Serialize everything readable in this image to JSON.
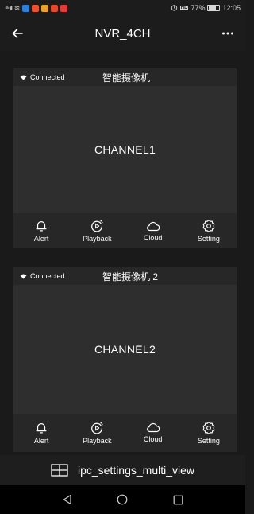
{
  "status_bar": {
    "signal": "⁴⁶.ıll",
    "wifi": "≋",
    "battery_text": "77%",
    "time": "12:05",
    "hd": "HD",
    "app_icon_colors": [
      "#2f7fd8",
      "#e5542c",
      "#e8a32a",
      "#e04a2f",
      "#e23b3b"
    ],
    "battery_level": 0.77
  },
  "app_bar": {
    "title": "NVR_4CH",
    "back_icon": "arrow-left-icon",
    "more_icon": "more-horizontal-icon"
  },
  "cameras": [
    {
      "status": "Connected",
      "name": "智能摄像机",
      "channel": "CHANNEL1",
      "actions": [
        {
          "label": "Alert",
          "icon": "bell-icon"
        },
        {
          "label": "Playback",
          "icon": "playback-icon"
        },
        {
          "label": "Cloud",
          "icon": "cloud-icon"
        },
        {
          "label": "Setting",
          "icon": "gear-icon"
        }
      ]
    },
    {
      "status": "Connected",
      "name": "智能摄像机 2",
      "channel": "CHANNEL2",
      "actions": [
        {
          "label": "Alert",
          "icon": "bell-icon"
        },
        {
          "label": "Playback",
          "icon": "playback-icon"
        },
        {
          "label": "Cloud",
          "icon": "cloud-icon"
        },
        {
          "label": "Setting",
          "icon": "gear-icon"
        }
      ]
    }
  ],
  "multi_view": {
    "label": "ipc_settings_multi_view",
    "icon": "grid-icon"
  },
  "nav": {
    "back_icon": "nav-back-icon",
    "home_icon": "nav-home-icon",
    "recents_icon": "nav-recents-icon"
  }
}
